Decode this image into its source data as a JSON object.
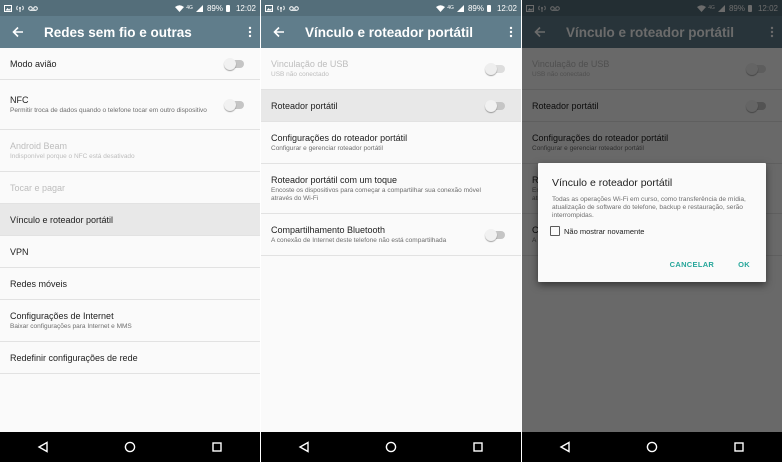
{
  "status": {
    "time": "12:02",
    "battery": "89%",
    "network": "4G"
  },
  "screen1": {
    "title": "Redes sem fio e outras",
    "items": [
      {
        "title": "Modo avião"
      },
      {
        "title": "NFC",
        "subtitle": "Permitir troca de dados quando o telefone tocar em outro dispositivo"
      },
      {
        "title": "Android Beam",
        "subtitle": "Indisponível porque o NFC está desativado"
      },
      {
        "title": "Tocar e pagar"
      },
      {
        "title": "Vínculo e roteador portátil"
      },
      {
        "title": "VPN"
      },
      {
        "title": "Redes móveis"
      },
      {
        "title": "Configurações de Internet",
        "subtitle": "Baixar configurações para Internet e MMS"
      },
      {
        "title": "Redefinir configurações de rede"
      }
    ]
  },
  "screen2": {
    "title": "Vínculo e roteador portátil",
    "items": [
      {
        "title": "Vinculação de USB",
        "subtitle": "USB não conectado"
      },
      {
        "title": "Roteador portátil"
      },
      {
        "title": "Configurações do roteador portátil",
        "subtitle": "Configurar e gerenciar roteador portátil"
      },
      {
        "title": "Roteador portátil com um toque",
        "subtitle": "Encoste os dispositivos para começar a compartilhar sua conexão móvel através do Wi-Fi"
      },
      {
        "title": "Compartilhamento Bluetooth",
        "subtitle": "A conexão de Internet deste telefone não está compartilhada"
      }
    ]
  },
  "dialog": {
    "title": "Vínculo e roteador portátil",
    "body": "Todas as operações Wi-Fi em curso, como transferência de mídia, atualização de software do telefone, backup e restauração, serão interrompidas.",
    "checkbox_label": "Não mostrar novamente",
    "cancel_label": "CANCELAR",
    "ok_label": "OK"
  },
  "colors": {
    "app_bar": "#607d8b",
    "status_bar": "#546e7a",
    "accent": "#26a69a",
    "highlight": "#e8e8e8",
    "nav_bar": "#000000"
  },
  "icons": {
    "back": "arrow-back-icon",
    "more": "more-vert-icon",
    "nav_back": "triangle-back-icon",
    "nav_home": "circle-home-icon",
    "nav_recent": "square-recent-icon"
  }
}
